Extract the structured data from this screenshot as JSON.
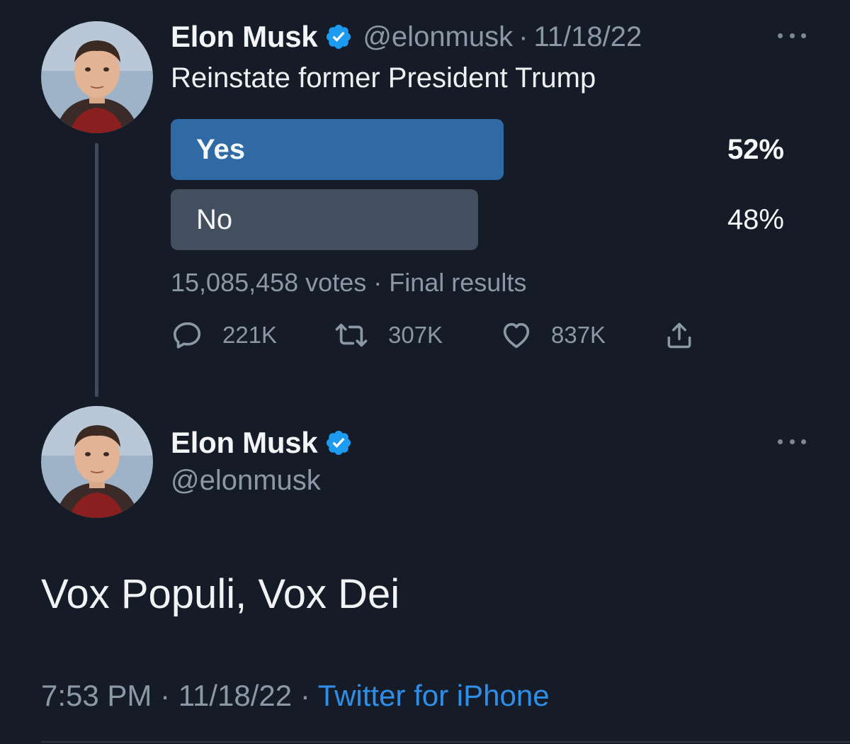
{
  "thread": {
    "tweet1": {
      "author": {
        "name": "Elon Musk",
        "handle": "@elonmusk",
        "verified": true
      },
      "separator": "·",
      "date": "11/18/22",
      "text": "Reinstate former President Trump",
      "poll": {
        "options": [
          {
            "label": "Yes",
            "percent_text": "52%",
            "percent": 52,
            "winner": true
          },
          {
            "label": "No",
            "percent_text": "48%",
            "percent": 48,
            "winner": false
          }
        ],
        "votes": "15,085,458 votes",
        "separator": "·",
        "status": "Final results"
      },
      "actions": {
        "reply_count": "221K",
        "retweet_count": "307K",
        "like_count": "837K"
      }
    },
    "tweet2": {
      "author": {
        "name": "Elon Musk",
        "handle": "@elonmusk",
        "verified": true
      },
      "text": "Vox Populi, Vox Dei",
      "time": "7:53 PM",
      "separator": "·",
      "date": "11/18/22",
      "source": "Twitter for iPhone"
    }
  },
  "icons": {
    "verified": "verified-badge-icon",
    "more": "more-horizontal-icon",
    "reply": "reply-icon",
    "retweet": "retweet-icon",
    "like": "heart-icon",
    "share": "share-icon"
  },
  "colors": {
    "background": "#151c28",
    "poll_winner": "#2f6aa5",
    "poll_other": "#434f5e",
    "link": "#2f8ee8",
    "secondary_text": "#8b98a5",
    "verified": "#1d9bf0"
  }
}
